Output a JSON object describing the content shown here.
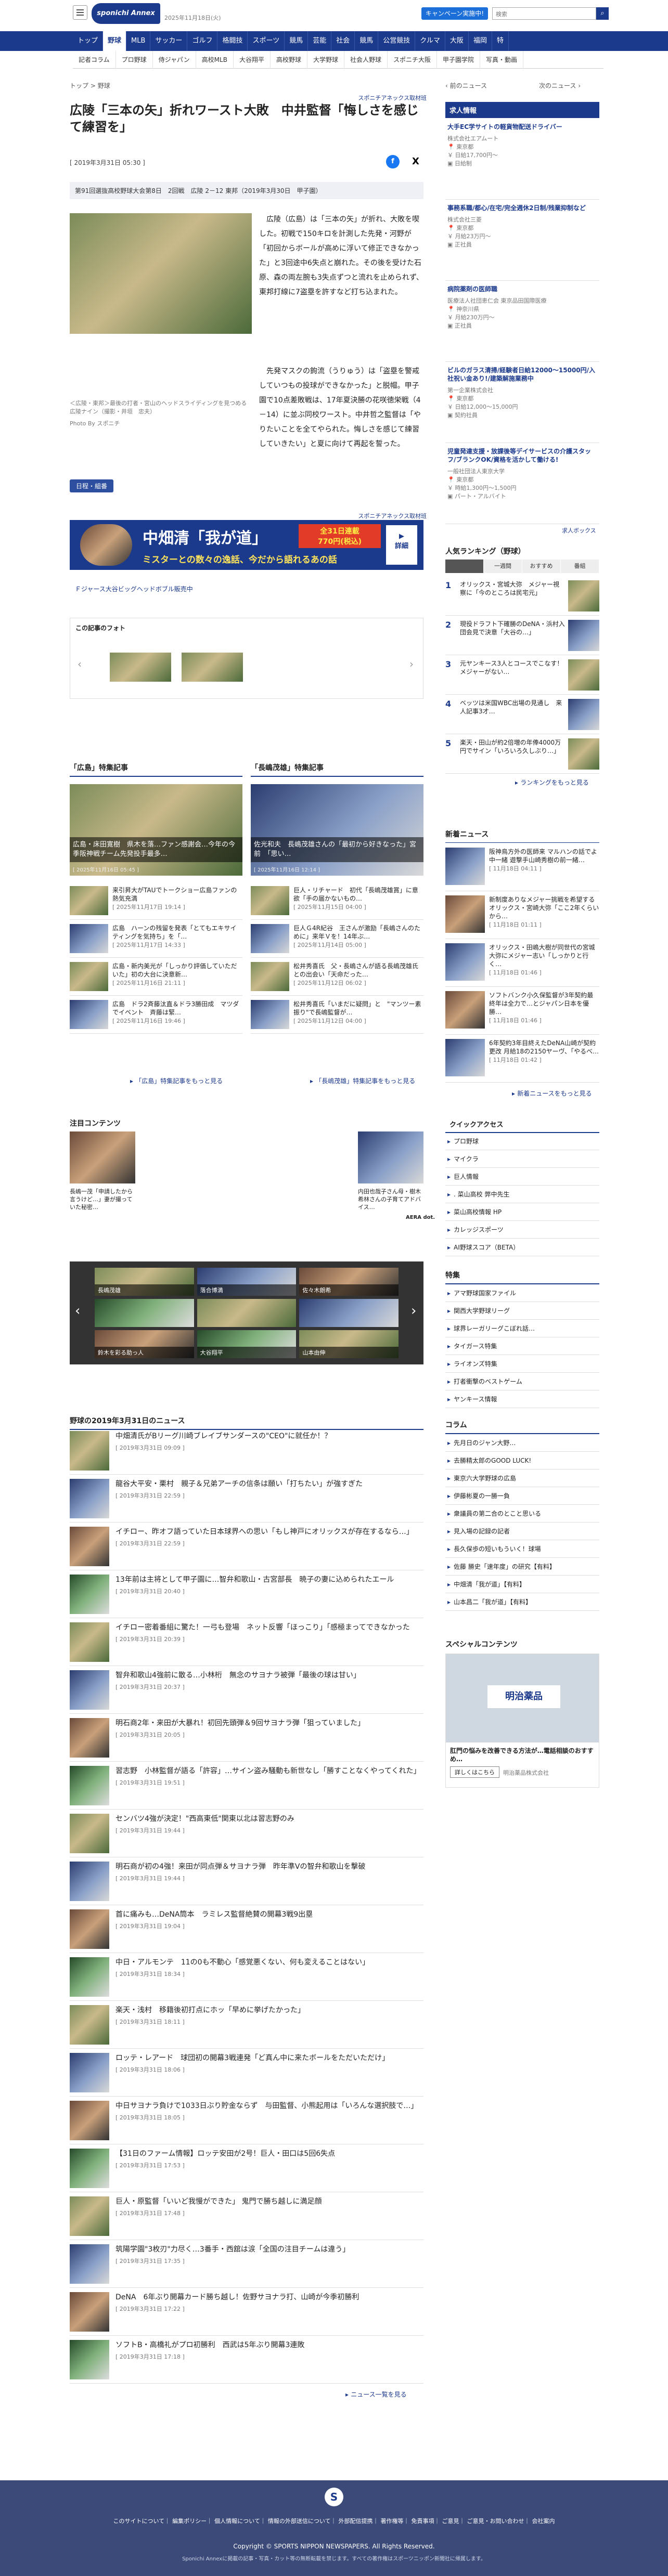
{
  "header": {
    "logo": "sponichi Annex",
    "date": "2025年11月18日(火)",
    "campaign": "キャンペーン実施中!",
    "search_placeholder": "検索"
  },
  "nav": [
    "トップ",
    "野球",
    "MLB",
    "サッカー",
    "ゴルフ",
    "格闘技",
    "スポーツ",
    "競馬",
    "芸能",
    "社会",
    "競馬",
    "公営競技",
    "クルマ",
    "大阪",
    "福岡",
    "特"
  ],
  "subnav": [
    "記者コラム",
    "プロ野球",
    "侍ジャパン",
    "高校MLB",
    "大谷翔平",
    "高校野球",
    "大学野球",
    "社会人野球",
    "スポニチ大阪",
    "甲子園学院",
    "写真・動画"
  ],
  "breadcrumb": {
    "home": "トップ",
    "sep": ">",
    "cat": "野球"
  },
  "article": {
    "source": "スポニチアネックス取材班",
    "title": "広陵「三本の矢」折れワースト大敗　中井監督「悔しさを感じて練習を」",
    "date": "[ 2019年3月31日 05:30 ]",
    "score": "第91回選抜高校野球大会第8日　2回戦　広陵 2－12 東邦（2019年3月30日　甲子園）",
    "photo_caption": "＜広陵・東邦＞最後の打者・宮山のヘッドスライディングを見つめる広陵ナイン（撮影・井垣　忠夫）",
    "photo_credit": "Photo By スポニチ",
    "p1": "広陵（広島）は「三本の矢」が折れ、大敗を喫した。初戦で150キロを計測した先発・河野が「初回からボールが高めに浮いて修正できなかった」と3回途中6失点と崩れた。その後を受けた石原、森の両左腕も3失点ずつと流れを止められず、東邦打線に7盗塁を許すなど打ち込まれた。",
    "p2": "先発マスクの鉤流（うりゅう）は「盗塁を警戒していつもの投球ができなかった」と脱帽。甲子園で10点差敗戦は、17年夏決勝の花咲徳栄戦（4－14）に並ぶ同校ワースト。中井哲之監督は「やりたいことを全てやられた。悔しさを感じて練習していきたい」と夏に向けて再起を誓った。",
    "tag": "日程・組番",
    "ad_source": "スポニチアネックス取材班",
    "promo_title": "中畑清「我が道」",
    "promo_badge": "全31日連載\n770円(税込)",
    "promo_sub": "ミスターとの数々の逸話、今だから語れるあの話",
    "promo_btn": "詳細",
    "promo_link": "Ｆジャース大谷ビッグヘッドボブル販売中"
  },
  "share": {
    "fb": "f",
    "x": "X"
  },
  "photos_label": "この記事のフォト",
  "related": {
    "left_title": "「広島」特集記事",
    "right_title": "「長嶋茂雄」特集記事",
    "left_main": "広島・床田寛樹　県木を落…ファン感謝会…今年の今季阪神戦チーム先発投手最多…",
    "left_main_date": "[ 2025年11月16日 05:45 ]",
    "right_main": "佐光和夫　長嶋茂雄さんの「最初から好きなった」宮前　「思い…",
    "right_main_date": "[ 2025年11月16日 12:14 ]",
    "left_items": [
      {
        "t": "来引昇大がTAUでトークショー広島ファンの熱気充満",
        "d": "[ 2025年11月17日 19:14 ]"
      },
      {
        "t": "広島　ハーンの残留を発表「とてもエキサイティングを気持ち」を「…",
        "d": "[ 2025年11月17日 14:33 ]"
      },
      {
        "t": "広島・新内美光が「しっかり評価していただいた」初の大台に決意新…",
        "d": "[ 2025年11月16日 21:11 ]"
      },
      {
        "t": "広島　ドラ2斉藤汰直＆ドラ3勝田成　マツダでイベント　斉藤は緊…",
        "d": "[ 2025年11月16日 19:46 ]"
      }
    ],
    "right_items": [
      {
        "t": "巨人・リチャード　初代「長嶋茂雄賞」に意欲「手の届かないもの…",
        "d": "[ 2025年11月15日 04:00 ]"
      },
      {
        "t": "巨人Ｇ4R紀谷　王さんが激励「長嶋さんのために」来年Ｖを！14年ぶ…",
        "d": "[ 2025年11月14日 05:00 ]"
      },
      {
        "t": "松井秀喜氏　父・長嶋さんが語る長嶋茂雄氏との出会い「天命だった…",
        "d": "[ 2025年11月12日 06:02 ]"
      },
      {
        "t": "松井秀喜氏「いまだに疑問」と　\"マンツー素振り\"で長嶋監督が…",
        "d": "[ 2025年11月12日 04:00 ]"
      }
    ],
    "left_more": "「広島」特集記事をもっと見る",
    "right_more": "「長嶋茂雄」特集記事をもっと見る"
  },
  "attention": {
    "title": "注目コンテンツ",
    "left": "長嶋一茂「申請したから言うけど…」妻が撮っていた秘密…",
    "right": "内田也哉子さん母・樹木希林さんの子育てアドバイス…",
    "right_credit": "AERA dot."
  },
  "slider": [
    "長嶋茂雄",
    "落合博満",
    "佐々木朗希",
    "",
    "",
    "",
    "鈴木を彩る助っ人",
    "大谷翔平",
    "山本由伸"
  ],
  "news": {
    "title": "野球の2019年3月31日のニュース",
    "items": [
      {
        "t": "中畑清氏がBリーグ川崎ブレイブサンダースの\"CEO\"に就任か！？",
        "d": "[ 2019年3月31日 09:09 ]"
      },
      {
        "t": "龍谷大平安・栗村　親子＆兄弟アーチの信条は願い「打ちたい」が強すぎた",
        "d": "[ 2019年3月31日 22:59 ]"
      },
      {
        "t": "イチロー、昨オフ語っていた日本球界への思い「もし神戸にオリックスが存在するなら…」",
        "d": "[ 2019年3月31日 22:59 ]"
      },
      {
        "t": "13年前は主将として甲子園に…智弁和歌山・古宮部長　暁子の妻に込められたエール",
        "d": "[ 2019年3月31日 20:40 ]"
      },
      {
        "t": "イチロー密着番組に驚た！一弓も登場　ネット反響「ほっこり」「感極まってできなかった",
        "d": "[ 2019年3月31日 20:39 ]"
      },
      {
        "t": "智弁和歌山4強前に散る…小林桁　無念のサヨナラ被弾「最後の球は甘い」",
        "d": "[ 2019年3月31日 20:37 ]"
      },
      {
        "t": "明石商2年・来田が大暴れ！初回先頭弾＆9回サヨナラ弾「狙っていました」",
        "d": "[ 2019年3月31日 20:05 ]"
      },
      {
        "t": "習志野　小林監督が語る「許容」…サイン盗み騒動も新世なし「勝すことなくやってくれた」",
        "d": "[ 2019年3月31日 19:51 ]"
      },
      {
        "t": "センバツ4強が決定！\"西高東低\"関東以北は習志野のみ",
        "d": "[ 2019年3月31日 19:44 ]"
      },
      {
        "t": "明石商が初の4強！来田が同点弾＆サヨナラ弾　昨年準Vの智弁和歌山を撃破",
        "d": "[ 2019年3月31日 19:44 ]"
      },
      {
        "t": "首に痛みも…DeNA筒本　ラミレス監督絶賛の開幕3戦9出塁",
        "d": "[ 2019年3月31日 19:04 ]"
      },
      {
        "t": "中日・アルモンテ　11の0も不動心「感覚悪くない、何も変えることはない」",
        "d": "[ 2019年3月31日 18:34 ]"
      },
      {
        "t": "楽天・浅村　移籍後初打点にホッ「早めに挙げたかった」",
        "d": "[ 2019年3月31日 18:11 ]"
      },
      {
        "t": "ロッテ・レアード　球団初の開幕3戦連発「ど真ん中に来たボールをただいただけ」",
        "d": "[ 2019年3月31日 18:06 ]"
      },
      {
        "t": "中日サヨナラ負けで1033日ぶり貯金ならず　与田監督、小熊起用は「いろんな選択肢で…」",
        "d": "[ 2019年3月31日 18:05 ]"
      },
      {
        "t": "【31日のファーム情報】ロッテ安田が2号！巨人・田口は5回6失点",
        "d": "[ 2019年3月31日 17:53 ]"
      },
      {
        "t": "巨人・原監督「いいど我慢ができた」 鬼門で勝ち越しに満足顔",
        "d": "[ 2019年3月31日 17:48 ]"
      },
      {
        "t": "筑陽学園\"3枚刃\"力尽く…3番手・西舘は涙「全国の注目チームは違う」",
        "d": "[ 2019年3月31日 17:35 ]"
      },
      {
        "t": "DeNA　6年ぶり開幕カード勝ち越し！佐野サヨナラ打、山崎が今季初勝利",
        "d": "[ 2019年3月31日 17:22 ]"
      },
      {
        "t": "ソフトB・高橋礼がプロ初勝利　西武は5年ぶり開幕3連敗",
        "d": "[ 2019年3月31日 17:18 ]"
      }
    ],
    "more": "ニュース一覧を見る"
  },
  "sidebar": {
    "prev": "前のニュース",
    "next": "次のニュース",
    "jobs_title": "求人情報",
    "jobs": [
      {
        "t": "大手EC学サイトの軽貨物配送ドライバー",
        "co": "株式会社エアムート",
        "a": "東京都",
        "p": "日給17,700円～",
        "s": "日給制"
      },
      {
        "t": "事務系職/都心/在宅/完全週休2日制/残業抑制など",
        "co": "株式会社三菱",
        "a": "東京都",
        "p": "月給23万円～",
        "s": "正社員"
      },
      {
        "t": "病院薬剤の医師職",
        "co": "医療法人社団恵仁会 東京品田国際医療",
        "a": "神奈川県",
        "p": "月給230万円～",
        "s": "正社員"
      },
      {
        "t": "ビルのガラス清掃/経験者日給12000～15000円/入社祝い金あり!/建築解施業務中",
        "co": "第一企業株式会社",
        "a": "東京都",
        "p": "日給12,000～15,000円",
        "s": "契約社員"
      },
      {
        "t": "児童発達支援・放課後等デイサービスの介護スタッフ/ブランクOK/資格を活かして働ける!",
        "co": "一般社団法人東京大学",
        "a": "東京都",
        "p": "時給1,300円～1,500円",
        "s": "パート・アルバイト"
      }
    ],
    "jobs_credit": "求人ボックス",
    "ranking_title": "人気ランキング（野球）",
    "ranking_tabs": [
      "",
      "一週間",
      "おすすめ",
      "番組"
    ],
    "ranking": [
      {
        "n": "1",
        "t": "オリックス・宮城大弥　メジャー視察に「今のところは民宅元」"
      },
      {
        "n": "2",
        "t": "現役ドラフト下確勝のDeNA・浜村入団会見で決意「大谷の…」"
      },
      {
        "n": "3",
        "t": "元ヤンキース3人とコースでこなす！メジャーがない…"
      },
      {
        "n": "4",
        "t": "ベッツは米国WBC出場の見通し　来人記事3才…"
      },
      {
        "n": "5",
        "t": "楽天・田山が約2倍増の年俸4000万円でサイン「いろいろ久しぶり…」"
      }
    ],
    "ranking_more": "ランキングをもっと見る",
    "new_title": "新着ニュース",
    "new": [
      {
        "t": "阪神鳥方外の医師来 マルハンの話でよ中一緒 遊撃手山崎秀樹の前一緒…",
        "d": "[ 11月18日 04:11 ]"
      },
      {
        "t": "新制度ありなメジャー挑戦を希望するオリックス・宮崎大弥「ここ2年くらいから…",
        "d": "[ 11月18日 01:11 ]"
      },
      {
        "t": "オリックス・田嶋大樹が同世代の宮城大弥にメジャー志い「しっかりと行く…",
        "d": "[ 11月18日 01:46 ]"
      },
      {
        "t": "ソフトバンク小久保監督が3年契約最終年は全力で…とジャパン日本を優勝…",
        "d": "[ 11月18日 01:46 ]"
      },
      {
        "t": "6年契約3年目終えたDeNA山崎が契約更改 月給18の2150ヤーヴ、「やるべ…",
        "d": "[ 11月18日 01:42 ]"
      }
    ],
    "new_more": "新着ニュースをもっと見る",
    "quick_title": "クイックアクセス",
    "quick": [
      "プロ野球",
      "マイクラ",
      "巨人情報",
      ". 菜山高校 弊中先生",
      "菜山高校情報 HP",
      "カレッジスポーツ",
      "AI野球スコア（BETA）"
    ],
    "feature_title": "特集",
    "features": [
      "アマ野球国家ファイル",
      "関西大学野球リーグ",
      "球界レーガリーグこぼれ話…",
      "タイガース特集",
      "ライオンズ特集",
      "打者衝撃のベストゲーム",
      "ヤンキース情報"
    ],
    "column_title": "コラム",
    "columns": [
      "先月日のジャン大野…",
      "去勝精太郎のGOOD LUCK!",
      "東京六大学野球の広島",
      "伊藤彬夏の一勝一負",
      "衆議員の第二合のとこと思いる",
      "見入場の記録の記者",
      "長久保歩の短いもういく！球場",
      "佐藤 勝史「速年度」の研究【有料】",
      "中畑清「我が道」【有料】",
      "山本昌二「我が道」【有料】"
    ],
    "special_title": "スペシャルコンテンツ",
    "special_brand": "明治薬品",
    "special_text": "肛門の悩みを改善できる方法が…電話相談のおすすめ…",
    "special_btn": "詳しくはこちら",
    "special_credit": "明治薬品株式会社"
  },
  "footer": {
    "links": [
      "このサイトについて",
      "編集ポリシー",
      "個人情報について",
      "情報の外部送信について",
      "外部配信提携",
      "著作権等",
      "免責事項",
      "ご意見",
      "ご意見・お問い合わせ",
      "会社案内"
    ],
    "copyright": "Copyright © SPORTS NIPPON NEWSPAPERS. All Rights Reserved.",
    "note": "Sponichi Annexに掲載の記事・写真・カット等の無断転載を禁じます。すべての著作権はスポーツニッポン新聞社に帰属します。",
    "logo": "S"
  },
  "colors": {
    "navy": "#1c3a8c",
    "footer": "#3b4a78",
    "promo": "#1c3a8c"
  }
}
